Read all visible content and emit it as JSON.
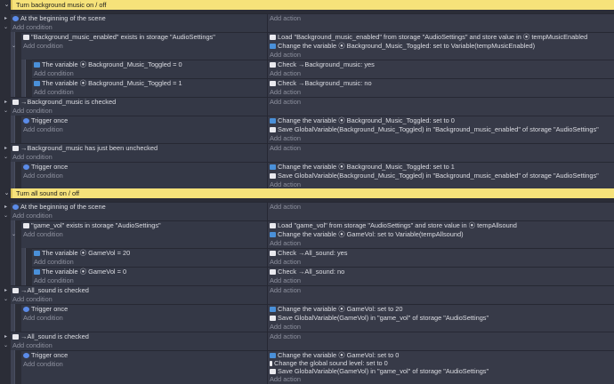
{
  "groups": [
    {
      "title": "Turn background music on / off"
    },
    {
      "title": "Turn all sound on / off"
    }
  ],
  "add_action": "Add action",
  "add_condition": "Add condition",
  "events": [
    {
      "conditions": [
        "At the beginning of the scene"
      ],
      "actions": []
    },
    {
      "conditions": [
        "\"Background_music_enabled\" exists in storage \"AudioSettings\""
      ],
      "actions": [
        "Load \"Background_music_enabled\" from storage \"AudioSettings\" and store value in ⦿ tempMusicEnabled",
        "Change the variable ⦿ Background_Music_Toggled: set to Variable(tempMusicEnabled)"
      ]
    },
    {
      "conditions": [
        "The variable ⦿ Background_Music_Toggled = 0"
      ],
      "actions": [
        "Check →Background_music: yes"
      ]
    },
    {
      "conditions": [
        "The variable ⦿ Background_Music_Toggled = 1"
      ],
      "actions": [
        "Check →Background_music: no"
      ]
    },
    {
      "conditions": [
        "→Background_music is checked"
      ],
      "actions": []
    },
    {
      "conditions": [
        "Trigger once"
      ],
      "actions": [
        "Change the variable ⦿ Background_Music_Toggled: set to 0",
        "Save GlobalVariable(Background_Music_Toggled) in \"Background_music_enabled\" of storage \"AudioSettings\""
      ]
    },
    {
      "conditions": [
        "→Background_music has just been unchecked"
      ],
      "actions": []
    },
    {
      "conditions": [
        "Trigger once"
      ],
      "actions": [
        "Change the variable ⦿ Background_Music_Toggled: set to 1",
        "Save GlobalVariable(Background_Music_Toggled) in \"Background_music_enabled\" of storage \"AudioSettings\""
      ]
    },
    {
      "conditions": [
        "At the beginning of the scene"
      ],
      "actions": []
    },
    {
      "conditions": [
        "\"game_vol\" exists in storage \"AudioSettings\""
      ],
      "actions": [
        "Load \"game_vol\" from storage \"AudioSettings\" and store value in ⦿ tempAllsound",
        "Change the variable ⦿ GameVol: set to Variable(tempAllsound)"
      ]
    },
    {
      "conditions": [
        "The variable ⦿ GameVol = 20"
      ],
      "actions": [
        "Check →All_sound: yes"
      ]
    },
    {
      "conditions": [
        "The variable ⦿ GameVol = 0"
      ],
      "actions": [
        "Check →All_sound: no"
      ]
    },
    {
      "conditions": [
        "→All_sound is checked"
      ],
      "actions": []
    },
    {
      "conditions": [
        "Trigger once"
      ],
      "actions": [
        "Change the variable ⦿ GameVol: set to 20",
        "Save GlobalVariable(GameVol) in \"game_vol\" of storage \"AudioSettings\""
      ]
    },
    {
      "conditions": [
        "→All_sound is checked"
      ],
      "actions": []
    },
    {
      "conditions": [
        "Trigger once"
      ],
      "actions": [
        "Change the variable ⦿ GameVol: set to 0",
        "Change the global sound level: set to 0",
        "Save GlobalVariable(GameVol) in \"game_vol\" of storage \"AudioSettings\""
      ]
    }
  ]
}
